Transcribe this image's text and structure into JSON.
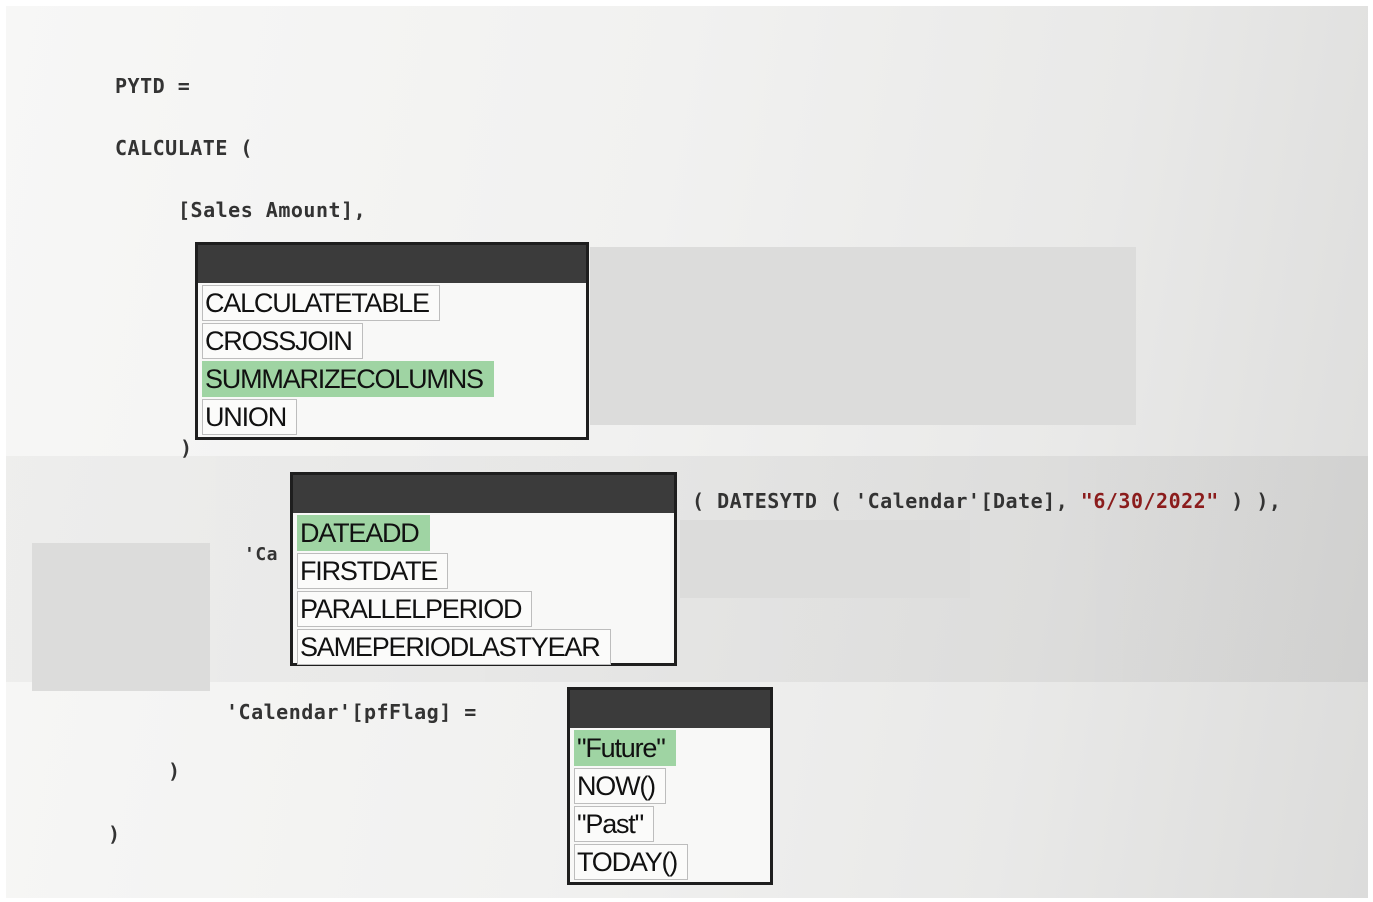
{
  "code": {
    "line1": "PYTD =",
    "line2": "CALCULATE (",
    "line3": "[Sales Amount],",
    "line4": ")",
    "line5_tail_a": "( DATESYTD ( 'Calendar'[Date], ",
    "line5_string": "\"6/30/2022\"",
    "line5_tail_b": " ) ),",
    "line6_partial": "'Ca",
    "line7": "'Calendar'[pfFlag] =",
    "line8": ")",
    "line9": ")"
  },
  "dropdown1": {
    "options": [
      "CALCULATETABLE",
      "CROSSJOIN",
      "SUMMARIZECOLUMNS",
      "UNION"
    ],
    "selected": "SUMMARIZECOLUMNS"
  },
  "dropdown2": {
    "options": [
      "DATEADD",
      "FIRSTDATE",
      "PARALLELPERIOD",
      "SAMEPERIODLASTYEAR"
    ],
    "selected": "DATEADD"
  },
  "dropdown3": {
    "options": [
      "\"Future\"",
      "NOW()",
      "\"Past\"",
      "TODAY()"
    ],
    "selected": "\"Future\""
  },
  "colors": {
    "selected_highlight": "#9fd4a3",
    "dropdown_header": "#3b3b3b",
    "string_literal": "#8b1c1c"
  }
}
